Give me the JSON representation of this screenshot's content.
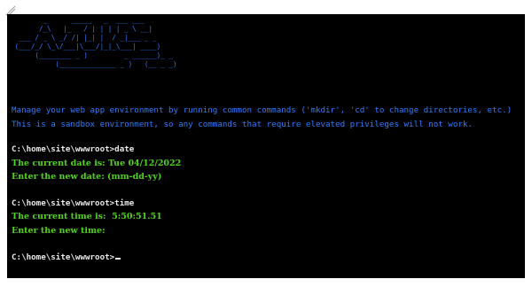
{
  "console": {
    "banner": "        _      _____   _  ___ ___\n       /_\\   |_   / | | | | _ \\ __|\n  ___ / _ \\ _/ /| |_| |  / _|___ _ _\n (___/_/ \\_\\/___|\\___/|_|_\\___| ____)\n      (________ _ )         _ ______)_ _\n           (______________ _ )   (__ _ _)",
    "intro_lines": [
      "Manage your web app environment by running common commands ('mkdir', 'cd' to change directories, etc.)",
      "This is a sandbox environment, so any commands that require elevated privileges will not work."
    ],
    "session": [
      {
        "type": "cmd",
        "text": "C:\\home\\site\\wwwroot>date"
      },
      {
        "type": "out",
        "text": "The current date is: Tue 04/12/2022"
      },
      {
        "type": "out",
        "text": "Enter the new date: (mm-dd-yy)"
      },
      {
        "type": "cmd",
        "text": "C:\\home\\site\\wwwroot>time"
      },
      {
        "type": "out",
        "text": "The current time is:  5:50:51.51"
      },
      {
        "type": "out",
        "text": "Enter the new time:"
      }
    ],
    "prompt": "C:\\home\\site\\wwwroot>",
    "colors": {
      "background": "#000000",
      "banner": "#2f7bff",
      "intro": "#2f7bff",
      "command": "#e8e8e8",
      "output": "#4fd41a"
    }
  }
}
